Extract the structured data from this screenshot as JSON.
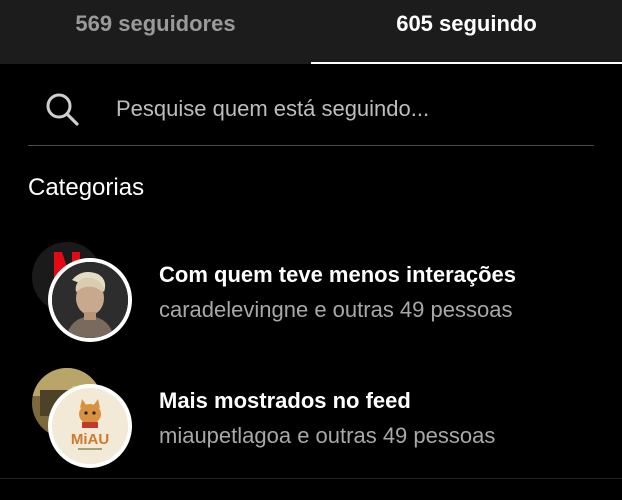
{
  "tabs": [
    {
      "label": "569 seguidores",
      "active": false
    },
    {
      "label": "605 seguindo",
      "active": true
    }
  ],
  "search": {
    "placeholder": "Pesquise quem está seguindo...",
    "icon": "search-icon"
  },
  "categories_title": "Categorias",
  "categories": [
    {
      "title": "Com quem teve menos interações",
      "subtitle": "caradelevingne e outras 49 pessoas",
      "front_avatar_icon": "person-avatar",
      "back_avatar_icon": "netflix-logo"
    },
    {
      "title": "Mais mostrados no feed",
      "subtitle": "miaupetlagoa e outras 49 pessoas",
      "front_avatar_logo_text": "MiAU",
      "back_avatar_icon": "photo-avatar"
    }
  ],
  "colors": {
    "background": "#000000",
    "tab_bar": "#1c1c1c",
    "active_text": "#ffffff",
    "inactive_text": "#9a9a9a",
    "secondary_text": "#a8a8a8",
    "divider": "#4a4a4a"
  }
}
